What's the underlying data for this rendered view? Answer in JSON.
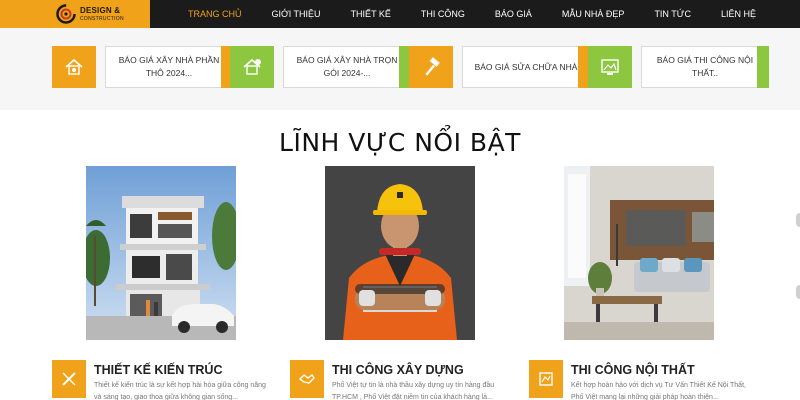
{
  "colors": {
    "accent": "#f0a21b",
    "green": "#8dc63f",
    "header_bg": "#1b1b1b"
  },
  "logo": {
    "brand": "DESIGN &",
    "sub": "CONSTRUCTION"
  },
  "nav": {
    "items": [
      {
        "label": "Trang chủ",
        "active": true
      },
      {
        "label": "Giới thiệu"
      },
      {
        "label": "Thiết kế"
      },
      {
        "label": "Thi công"
      },
      {
        "label": "Báo giá"
      },
      {
        "label": "Mẫu nhà đẹp"
      },
      {
        "label": "Tin tức"
      },
      {
        "label": "Liên hệ"
      }
    ]
  },
  "quotes": [
    {
      "label": "Báo giá xây nhà phần thô 2024...",
      "icon": "house-coin-icon",
      "color": "orange"
    },
    {
      "label": "Báo giá xây nhà trọn gói 2024-...",
      "icon": "house-money-icon",
      "color": "green"
    },
    {
      "label": "Báo giá sửa chữa nhà",
      "icon": "hammer-icon",
      "color": "orange"
    },
    {
      "label": "Báo giá thi công nội thất..",
      "icon": "interior-icon",
      "color": "green"
    }
  ],
  "section": {
    "title": "LĨNH VỰC NỔI BẬT"
  },
  "features": [
    {
      "title": "THIẾT KẾ KIẾN TRÚC",
      "desc": "Thiết kế kiến trúc là sự kết hợp hài hòa giữa công năng và sáng tạo, giao thoa giữa không gian sống...",
      "icon": "pencil-ruler-icon"
    },
    {
      "title": "THI CÔNG XÂY DỰNG",
      "desc": "Phố Việt tự tin là nhà thầu xây dựng uy tín hàng đầu TP.HCM , Phố Việt đặt niềm tin của khách hàng lả...",
      "icon": "handshake-icon"
    },
    {
      "title": "THI CÔNG NỘI THẤT",
      "desc": "Kết hợp hoàn hảo với dịch vụ Tư Vấn Thiết Kế Nội Thất, Phố Việt mang lại những giải pháp hoàn thiện...",
      "icon": "blueprint-icon"
    }
  ]
}
